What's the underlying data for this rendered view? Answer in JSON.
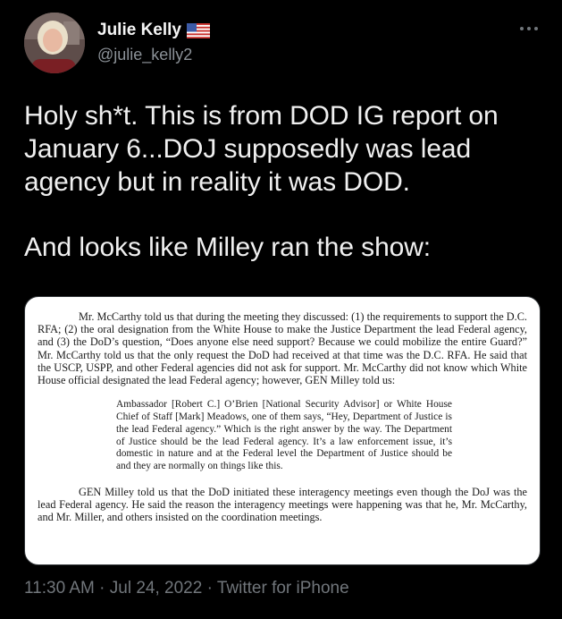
{
  "author": {
    "display_name": "Julie Kelly",
    "handle": "@julie_kelly2",
    "flag_icon": "us-flag-icon",
    "avatar_icon": "profile-photo-avatar"
  },
  "tweet": {
    "paragraph1": "Holy sh*t. This is from DOD IG report on January 6...DOJ supposedly was lead agency but in reality it was DOD.",
    "paragraph2": "And looks like Milley ran the show:"
  },
  "media": {
    "p1": "Mr. McCarthy told us that during the meeting they discussed:  (1) the requirements to support the D.C. RFA; (2) the oral designation from the White House to make the Justice Department the lead Federal agency, and (3) the DoD’s question, “Does anyone else need support? Because we could mobilize the entire Guard?”  Mr. McCarthy told us that the only request the DoD had received at that time was the D.C. RFA.  He said that the USCP, USPP, and other Federal agencies did not ask for support.  Mr. McCarthy did not know which White House official designated the lead Federal agency; however, GEN Milley told us:",
    "quote": "Ambassador [Robert C.] O’Brien [National Security Advisor] or White House Chief of Staff [Mark] Meadows, one of them says, “Hey, Department of Justice is the lead Federal agency.”  Which is the right answer by the way.  The Department of Justice should be the lead Federal agency.  It’s a law enforcement issue, it’s domestic in nature and at the Federal level the Department of Justice should be and they are normally on things like this.",
    "p3": "GEN Milley told us that the DoD initiated these interagency meetings even though the DoJ was the lead Federal agency.  He said the reason the interagency meetings were happening was that he, Mr. McCarthy, and Mr. Miller, and others insisted on the coordination meetings."
  },
  "meta": {
    "time": "11:30 AM",
    "separator": " · ",
    "date": "Jul 24, 2022",
    "source": "Twitter for iPhone"
  },
  "more_icon": "more-options-icon",
  "colors": {
    "background": "#000000",
    "text": "#e7e9ea",
    "secondary_text": "#71767b"
  }
}
